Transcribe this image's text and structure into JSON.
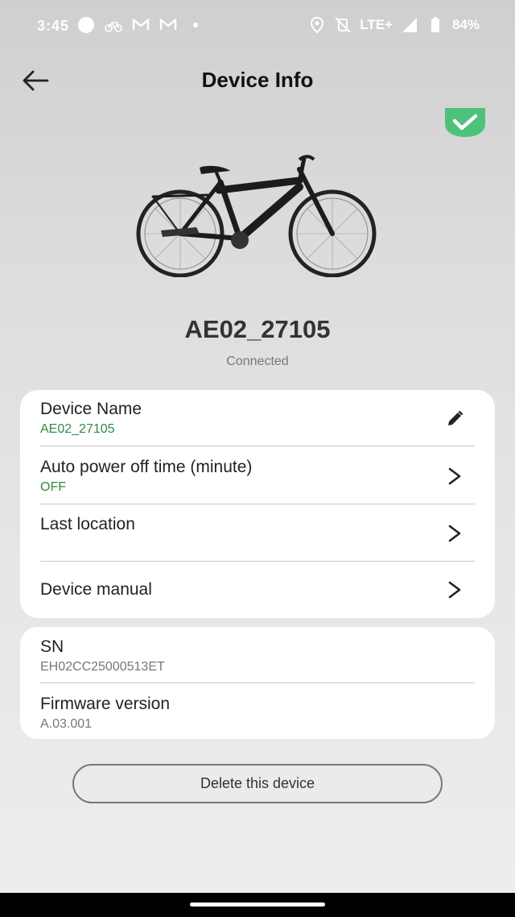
{
  "status_bar": {
    "time": "3:45",
    "network": "LTE+",
    "battery": "84%",
    "left_icons": [
      "circle-icon",
      "bike-notification-icon",
      "gmail-icon",
      "gmail-icon",
      "dot-icon"
    ],
    "right_icons": [
      "location-icon",
      "vibrate-mute-icon",
      "signal-icon",
      "battery-icon"
    ]
  },
  "header": {
    "title": "Device Info",
    "back_icon": "arrow-left-icon"
  },
  "device": {
    "name": "AE02_27105",
    "status": "Connected",
    "connected_badge_color": "#4cc27a"
  },
  "settings": {
    "device_name_label": "Device Name",
    "device_name_value": "AE02_27105",
    "auto_power_label": "Auto power off time (minute)",
    "auto_power_value": "OFF",
    "last_location_label": "Last location",
    "manual_label": "Device manual"
  },
  "info": {
    "sn_label": "SN",
    "sn_value": "EH02CC25000513ET",
    "firmware_label": "Firmware version",
    "firmware_value": "A.03.001"
  },
  "actions": {
    "delete_label": "Delete this device"
  },
  "colors": {
    "accent_green": "#2e8b46",
    "badge_green": "#4cc27a"
  }
}
